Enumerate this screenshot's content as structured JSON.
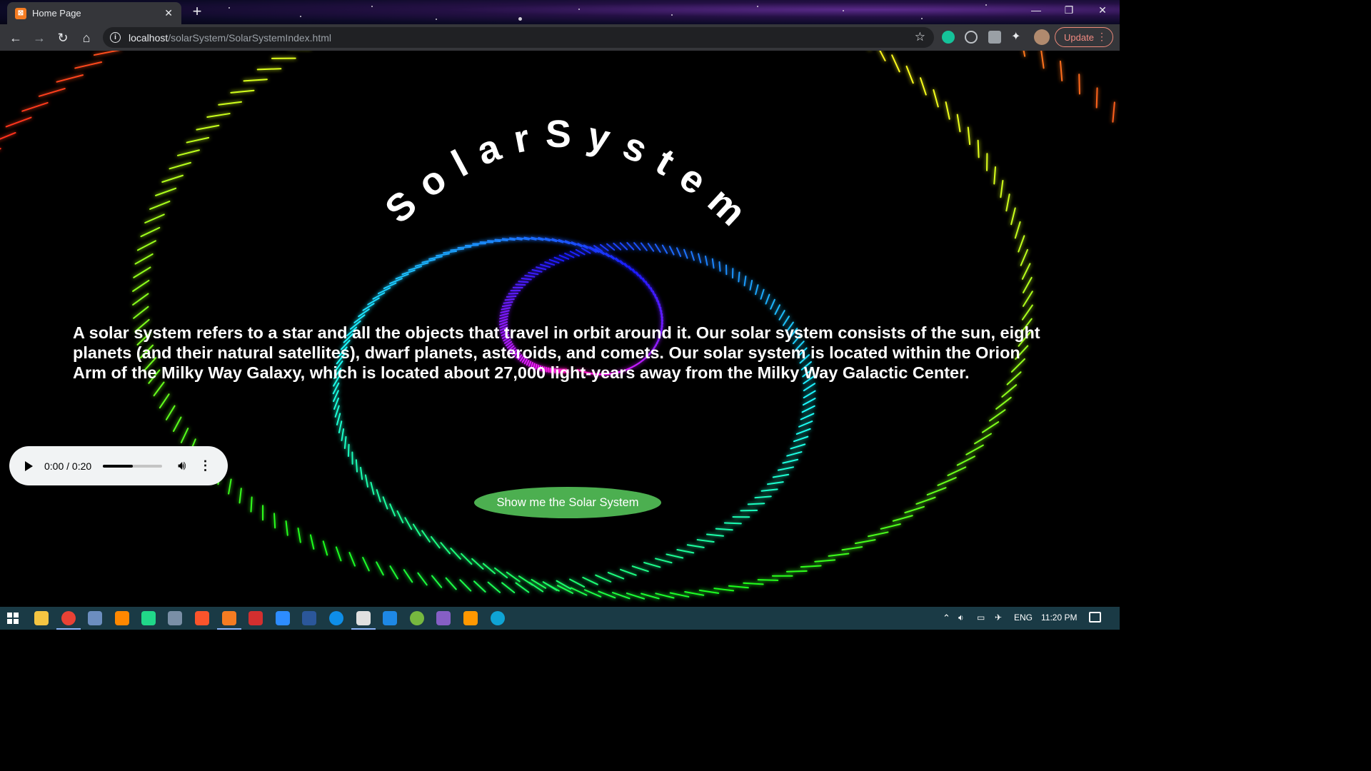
{
  "browser": {
    "tab_title": "Home Page",
    "tab_favicon_text": "⊠",
    "url_host": "localhost",
    "url_path": "/solarSystem/SolarSystemIndex.html",
    "update_label": "Update"
  },
  "page": {
    "heading": "SolarSystem",
    "description": "A solar system refers to a star and all the objects that travel in orbit around it. Our solar system consists of the sun, eight planets (and their natural satellites), dwarf planets, asteroids, and comets. Our solar system is located within the Orion Arm of the Milky Way Galaxy, which is located about 27,000 light-years away from the Milky Way Galactic Center.",
    "audio": {
      "time": "0:00 / 0:20",
      "volume_level": 0.5
    },
    "show_button_label": "Show me the Solar System"
  },
  "taskbar": {
    "language": "ENG",
    "clock": "11:20 PM",
    "apps": [
      "file-explorer",
      "chrome",
      "shield-app",
      "vlc",
      "pycharm",
      "virtualbox",
      "brave",
      "xampp",
      "acrobat",
      "zoom",
      "word",
      "teamviewer",
      "blender",
      "azure-data-studio",
      "utorrent",
      "visual-studio",
      "sublime-text",
      "edge"
    ]
  },
  "colors": {
    "button_green": "#4caf50",
    "spiral": [
      "#ff0000",
      "#ff8800",
      "#ffee00",
      "#00ee00",
      "#00aaff",
      "#2222ff",
      "#aa00ff",
      "#ff00aa"
    ]
  }
}
